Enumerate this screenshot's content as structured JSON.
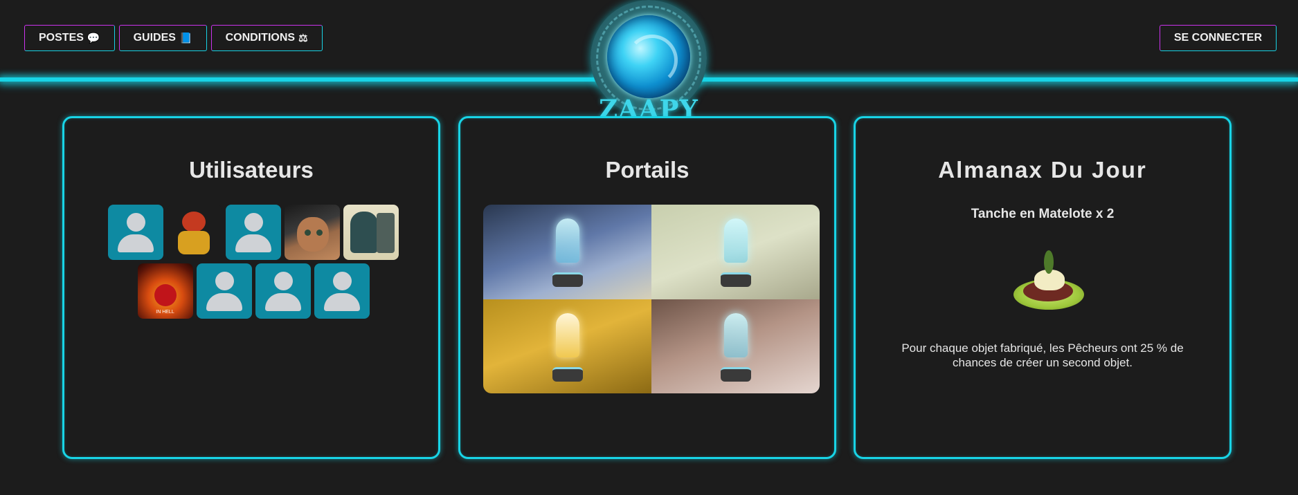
{
  "nav": {
    "posts_label": "POSTES",
    "guides_label": "GUIDES",
    "conditions_label": "CONDITIONS",
    "login_label": "SE CONNECTER"
  },
  "logo": {
    "text": "ZAAPY"
  },
  "users_card": {
    "title": "Utilisateurs",
    "avatars": [
      "default",
      "character",
      "default",
      "cat-photo",
      "hooded-character",
      "fire-meme",
      "default",
      "default",
      "default"
    ],
    "fire_caption": "IN HELL"
  },
  "portals_card": {
    "title": "Portails",
    "images": [
      "portal-blue",
      "portal-pale",
      "portal-gold",
      "portal-pink"
    ]
  },
  "almanax_card": {
    "title": "Almanax Du Jour",
    "item": "Tanche en Matelote x 2",
    "bonus": "Pour chaque objet fabriqué, les Pêcheurs ont 25 % de chances de créer un second objet."
  },
  "colors": {
    "accent": "#18d4e6",
    "magenta": "#cc33ee",
    "background": "#1c1c1c",
    "avatar_default": "#0e8aa2"
  },
  "icons": {
    "posts": "comments-icon",
    "guides": "book-icon",
    "conditions": "scale-icon"
  }
}
